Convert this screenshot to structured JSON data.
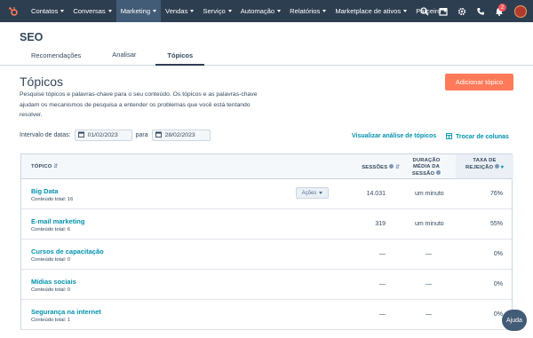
{
  "nav": {
    "items": [
      {
        "label": "Contatos"
      },
      {
        "label": "Conversas"
      },
      {
        "label": "Marketing"
      },
      {
        "label": "Vendas"
      },
      {
        "label": "Serviço"
      },
      {
        "label": "Automação"
      },
      {
        "label": "Relatórios"
      },
      {
        "label": "Marketplace de ativos"
      },
      {
        "label": "Parceiro"
      }
    ],
    "notification_count": "2",
    "brand_color": "#ff7a59"
  },
  "page": {
    "title": "SEO",
    "tabs": [
      {
        "label": "Recomendações"
      },
      {
        "label": "Analisar"
      },
      {
        "label": "Tópicos"
      }
    ]
  },
  "section": {
    "title": "Tópicos",
    "add_button": "Adicionar tópico",
    "description": "Pesquise tópicos e palavras-chave para o seu conteúdo. Os tópicos e as palavras-chave ajudam os mecanismos de pesquisa a entender os problemas que você está tentando resolver."
  },
  "filters": {
    "date_label": "Intervalo de datas:",
    "start": "01/02/2023",
    "to_label": "para",
    "end": "28/02/2023",
    "view_link": "Visualizar análise de tópicos",
    "swap_link": "Trocar de colunas"
  },
  "table": {
    "headers": {
      "topic": "TÓPICO",
      "sessions": "SESSÕES",
      "duration_1": "DURAÇÃO",
      "duration_2": "MÉDIA DA",
      "duration_3": "SESSÃO",
      "bounce_1": "TAXA DE",
      "bounce_2": "REJEIÇÃO"
    },
    "actions_label": "Ações",
    "rows": [
      {
        "name": "Big Data",
        "sub": "Conteúdo total: 16",
        "sessions": "14.031",
        "duration": "um minuto",
        "bounce": "76%"
      },
      {
        "name": "E-mail marketing",
        "sub": "Conteúdo total: 6",
        "sessions": "319",
        "duration": "um minuto",
        "bounce": "55%"
      },
      {
        "name": "Cursos de capacitação",
        "sub": "Conteúdo total: 0",
        "sessions": "—",
        "duration": "—",
        "bounce": "0%"
      },
      {
        "name": "Mídias sociais",
        "sub": "Conteúdo total: 0",
        "sessions": "—",
        "duration": "—",
        "bounce": "0%"
      },
      {
        "name": "Segurança na internet",
        "sub": "Conteúdo total: 1",
        "sessions": "—",
        "duration": "—",
        "bounce": "0%"
      }
    ]
  },
  "help": {
    "label": "Ajuda"
  }
}
